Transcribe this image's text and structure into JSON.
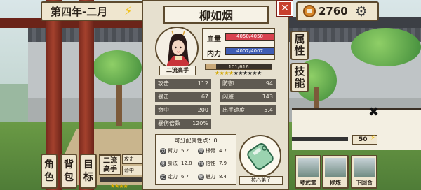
{
  "hud": {
    "date": "第四年-二月",
    "gold": "2760"
  },
  "bottom_left": {
    "buttons": [
      {
        "label_1": "角",
        "label_2": "色"
      },
      {
        "label_1": "背",
        "label_2": "包"
      },
      {
        "label_1": "目",
        "label_2": "标"
      }
    ],
    "rank_line_1": "二流",
    "rank_line_2": "高手",
    "small_1": "攻击",
    "small_2": "命中",
    "stars": "★★★★"
  },
  "side_tabs": [
    {
      "label_1": "属",
      "label_2": "性"
    },
    {
      "label_1": "技",
      "label_2": "能"
    }
  ],
  "energy": "50",
  "actions": [
    {
      "label": "考武堂"
    },
    {
      "label": "修炼"
    },
    {
      "label": "下回合"
    }
  ],
  "character": {
    "name": "柳如烟",
    "rank": "二流高手",
    "hp_label": "血量",
    "hp_value": "4050/4050",
    "mp_label": "内力",
    "mp_value": "4007/4007",
    "exp_value": "101/616",
    "exp_fraction": 0.164,
    "stars_filled": 4,
    "stars_total": 10,
    "stats": [
      {
        "label": "攻击",
        "value": "112"
      },
      {
        "label": "防御",
        "value": "94"
      },
      {
        "label": "暴击",
        "value": "67"
      },
      {
        "label": "闪避",
        "value": "143"
      },
      {
        "label": "命中",
        "value": "200"
      },
      {
        "label": "出手速度",
        "value": "5.4"
      },
      {
        "label": "暴伤倍数",
        "value": "120%"
      }
    ],
    "points_title": "可分配属性点：0",
    "attributes": [
      {
        "label": "臂力",
        "value": "5.2"
      },
      {
        "label": "根骨",
        "value": "4.7"
      },
      {
        "label": "身法",
        "value": "12.8"
      },
      {
        "label": "悟性",
        "value": "7.9"
      },
      {
        "label": "定力",
        "value": "6.7"
      },
      {
        "label": "魅力",
        "value": "8.4"
      }
    ],
    "core_label": "核心弟子"
  },
  "colors": {
    "panel_bg": "#e6e0cf",
    "hp": "#d8424f",
    "mp": "#3f5db4",
    "close": "#c8402e",
    "jade": "#9bd3b0"
  },
  "icons": [
    "lightning-icon",
    "coin-icon",
    "gear-icon",
    "close-icon",
    "jade-token-icon"
  ]
}
